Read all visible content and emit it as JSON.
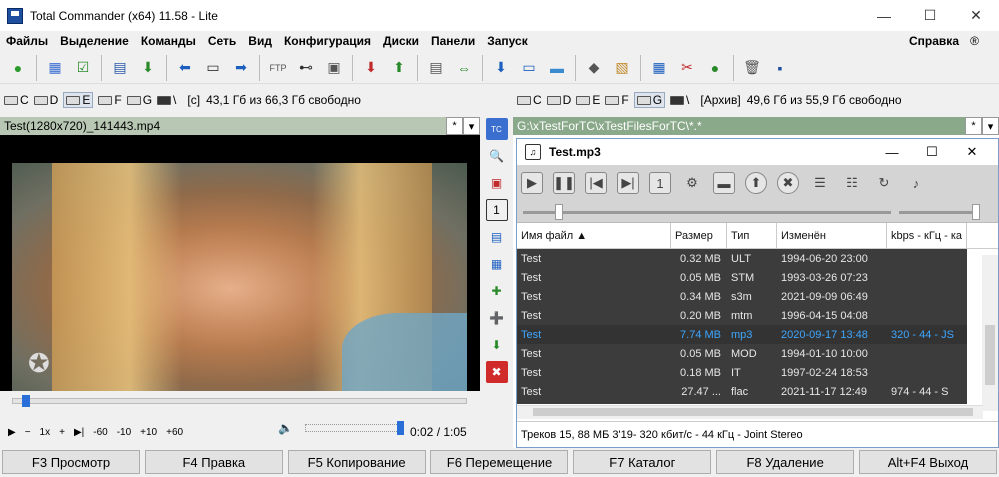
{
  "window": {
    "title": "Total Commander (x64) 11.58 - Lite",
    "minimize": "—",
    "maximize": "☐",
    "close": "✕"
  },
  "menu": {
    "items": [
      "Файлы",
      "Выделение",
      "Команды",
      "Сеть",
      "Вид",
      "Конфигурация",
      "Диски",
      "Панели",
      "Запуск"
    ],
    "help": "Справка",
    "reg": "®"
  },
  "toolbar": {
    "icons": [
      "person-icon",
      "compare-dirs-icon",
      "checklist-icon",
      "view-mode-icon",
      "download-icon",
      "arrow-left-icon",
      "terminal-icon",
      "arrow-right-icon",
      "ftp-icon",
      "binoculars-icon",
      "disk-icon",
      "pack-icon",
      "unpack-icon",
      "notepad-icon",
      "sync-icon",
      "save-icon",
      "monitor-icon",
      "monitor-blue-icon",
      "tool-icon",
      "notes-icon",
      "copy-icon",
      "plugin-icon",
      "settings-icon",
      "recycle-icon",
      "floppy-icon"
    ]
  },
  "left_drives": {
    "drives": [
      "C",
      "D",
      "E",
      "F",
      "G"
    ],
    "active": "E",
    "root": "\\",
    "label": "[c]",
    "free": "43,1 Гб из 66,3 Гб свободно"
  },
  "right_drives": {
    "drives": [
      "C",
      "D",
      "E",
      "F",
      "G"
    ],
    "active": "G",
    "root": "\\",
    "label": "[Архив]",
    "free": "49,6 Гб из 55,9 Гб свободно"
  },
  "left_panel": {
    "path": "Test(1280x720)_141443.mp4",
    "star": "*",
    "arrow": "▾",
    "controls": {
      "play": "▶",
      "minus": "−",
      "speed": "1x",
      "plus": "+",
      "frame": "▶|",
      "skips": [
        "-60",
        "-10",
        "+10",
        "+60"
      ],
      "volume_icon": "🔈",
      "volume_fraction": 0.97,
      "seek_fraction": 0.02,
      "time": "0:02 / 1:05"
    },
    "watermark": "✪"
  },
  "right_panel": {
    "path": "G:\\xTestForTC\\xTestFilesForTC\\*.*",
    "star": "*",
    "arrow": "▾",
    "player": {
      "title": "Test.mp3",
      "buttons": [
        "play-icon",
        "pause-icon",
        "previous-icon",
        "next-icon",
        "one-icon",
        "gear-icon",
        "minimize-bar-icon",
        "up-icon",
        "close-circle-icon",
        "playlist-icon",
        "list-icon",
        "repeat-icon",
        "note-icon"
      ],
      "button_glyphs": [
        "▶",
        "❚❚",
        "|◀",
        "▶|",
        "1",
        "⚙",
        "▬",
        "⬆",
        "✖",
        "☰",
        "☷",
        "↻",
        "♪"
      ],
      "columns": [
        "Имя файл ▲",
        "Размер",
        "Тип",
        "Изменён",
        "kbps - кГц - ка"
      ],
      "rows": [
        {
          "name": "Test",
          "size": "0.32 MB",
          "type": "ULT",
          "date": "1994-06-20 23:00",
          "info": ""
        },
        {
          "name": "Test",
          "size": "0.05 MB",
          "type": "STM",
          "date": "1993-03-26 07:23",
          "info": ""
        },
        {
          "name": "Test",
          "size": "0.34 MB",
          "type": "s3m",
          "date": "2021-09-09 06:49",
          "info": ""
        },
        {
          "name": "Test",
          "size": "0.20 MB",
          "type": "mtm",
          "date": "1996-04-15 04:08",
          "info": ""
        },
        {
          "name": "Test",
          "size": "7.74 MB",
          "type": "mp3",
          "date": "2020-09-17 13:48",
          "info": "320 - 44 - JS",
          "selected": true
        },
        {
          "name": "Test",
          "size": "0.05 MB",
          "type": "MOD",
          "date": "1994-01-10 10:00",
          "info": ""
        },
        {
          "name": "Test",
          "size": "0.18 MB",
          "type": "IT",
          "date": "1997-02-24 18:53",
          "info": ""
        },
        {
          "name": "Test",
          "size": "27.47 ...",
          "type": "flac",
          "date": "2021-11-17 12:49",
          "info": "974 - 44 - S"
        }
      ],
      "status": "Треков 15, 88 MБ  3'19- 320 кбит/с - 44 кГц - Joint Stereo"
    }
  },
  "middle_buttons": [
    "tc-icon",
    "search-icon",
    "multi-window-icon",
    "one-icon",
    "columns-icon",
    "panel-icon",
    "edit-plus-icon",
    "add-icon",
    "download-green-icon",
    "delete-red-icon"
  ],
  "middle_glyphs": [
    "TC",
    "🔍",
    "▣",
    "1",
    "▤",
    "▦",
    "✚",
    "➕",
    "⬇",
    "✖"
  ],
  "fkeys": [
    "F3 Просмотр",
    "F4 Правка",
    "F5 Копирование",
    "F6 Перемещение",
    "F7 Каталог",
    "F8 Удаление",
    "Alt+F4 Выход"
  ]
}
